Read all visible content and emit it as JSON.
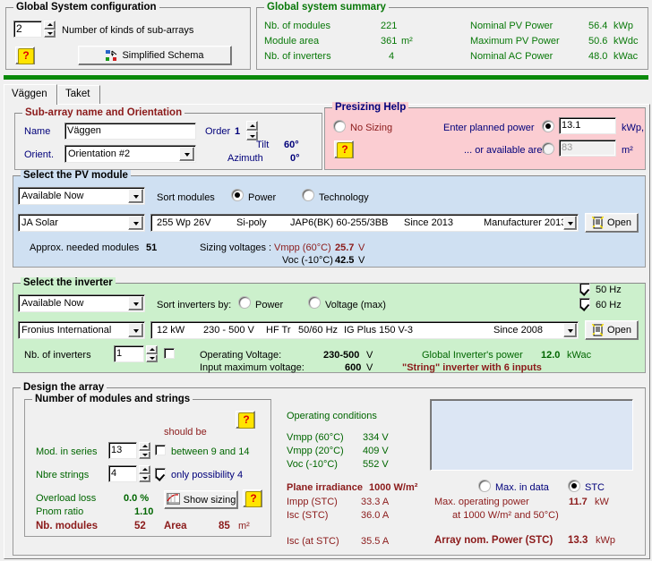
{
  "global_config": {
    "title": "Global System configuration",
    "subarray_kinds_value": "2",
    "subarray_kinds_label": "Number of kinds of sub-arrays",
    "simplified_schema_button": "Simplified Schema",
    "help_icon": "help-question-icon"
  },
  "global_summary": {
    "title": "Global system summary",
    "rows_left": [
      {
        "label": "Nb. of modules",
        "value": "221",
        "unit": ""
      },
      {
        "label": "Module area",
        "value": "361",
        "unit": "m²"
      },
      {
        "label": "Nb. of inverters",
        "value": "4",
        "unit": ""
      }
    ],
    "rows_right": [
      {
        "label": "Nominal PV Power",
        "value": "56.4",
        "unit": "kWp"
      },
      {
        "label": "Maximum PV Power",
        "value": "50.6",
        "unit": "kWdc"
      },
      {
        "label": "Nominal AC Power",
        "value": "48.0",
        "unit": "kWac"
      }
    ]
  },
  "tabs": [
    {
      "label": "Väggen",
      "active": true
    },
    {
      "label": "Taket",
      "active": false
    }
  ],
  "subarray": {
    "title": "Sub-array name and Orientation",
    "name_label": "Name",
    "name_value": "Väggen",
    "orient_label": "Orient.",
    "orient_value": "Orientation #2",
    "order_label": "Order",
    "order_value": "1",
    "tilt_label": "Tilt",
    "tilt_value": "60°",
    "azimuth_label": "Azimuth",
    "azimuth_value": "0°"
  },
  "presizing": {
    "title": "Presizing Help",
    "no_sizing_label": "No Sizing",
    "no_sizing_selected": false,
    "planned_power_label": "Enter planned power",
    "planned_power_selected": true,
    "planned_power_value": "13.1",
    "planned_power_unit": "kWp,",
    "available_area_label": "... or available area",
    "available_area_selected": false,
    "available_area_value": "83",
    "available_area_unit": "m²"
  },
  "pv_module": {
    "title": "Select the PV module",
    "availability_value": "Available Now",
    "sort_label": "Sort modules",
    "sort_power_label": "Power",
    "sort_power_selected": true,
    "sort_technology_label": "Technology",
    "sort_technology_selected": false,
    "manufacturer_value": "JA Solar",
    "model": {
      "power": "255 Wp 26V",
      "tech": "Si-poly",
      "code": "JAP6(BK) 60-255/3BB",
      "since": "Since 2013",
      "source": "Manufacturer 2013"
    },
    "open_button": "Open",
    "approx_label": "Approx. needed modules",
    "approx_value": "51",
    "sizing_voltages_label": "Sizing voltages :",
    "vmpp_label": "Vmpp (60°C)",
    "vmpp_value": "25.7",
    "vmpp_unit": "V",
    "voc_label": "Voc  (-10°C)",
    "voc_value": "42.5",
    "voc_unit": "V"
  },
  "inverter": {
    "title": "Select the inverter",
    "availability_value": "Available Now",
    "sort_label": "Sort inverters by:",
    "sort_power_label": "Power",
    "sort_power_selected": false,
    "sort_voltage_label": "Voltage (max)",
    "sort_voltage_selected": false,
    "freq_50_label": "50 Hz",
    "freq_50_checked": true,
    "freq_60_label": "60 Hz",
    "freq_60_checked": true,
    "manufacturer_value": "Fronius International",
    "model": {
      "power": "12 kW",
      "voltage": "230 - 500 V",
      "type": "HF Tr",
      "freq": "50/60 Hz",
      "name": "IG Plus 150 V-3",
      "since": "Since 2008"
    },
    "open_button": "Open",
    "nb_inverters_label": "Nb. of inverters",
    "nb_inverters_value": "1",
    "nb_inverters_checked": false,
    "operating_voltage_label": "Operating Voltage:",
    "operating_voltage_value": "230-500",
    "operating_voltage_unit": "V",
    "input_max_voltage_label": "Input maximum voltage:",
    "input_max_voltage_value": "600",
    "input_max_voltage_unit": "V",
    "global_power_label": "Global Inverter's power",
    "global_power_value": "12.0",
    "global_power_unit": "kWac",
    "string_note": "\"String\" inverter with 6 inputs"
  },
  "design": {
    "title": "Design the array",
    "modules_strings": {
      "title": "Number of modules and strings",
      "should_be_label": "should be",
      "mod_series_label": "Mod. in series",
      "mod_series_value": "13",
      "mod_series_checked": false,
      "between_label": "between 9 and 14",
      "nbre_strings_label": "Nbre strings",
      "nbre_strings_value": "4",
      "only_possibility_checked": true,
      "only_possibility_label": "only possibility 4",
      "overload_loss_label": "Overload loss",
      "overload_loss_value": "0.0 %",
      "pnom_ratio_label": "Pnom ratio",
      "pnom_ratio_value": "1.10",
      "show_sizing_button": "Show sizing",
      "nb_modules_label": "Nb. modules",
      "nb_modules_value": "52",
      "area_label": "Area",
      "area_value": "85",
      "area_unit": "m²"
    },
    "operating_conditions": {
      "title": "Operating conditions",
      "rows": [
        {
          "label": "Vmpp (60°C)",
          "value": "334 V"
        },
        {
          "label": "Vmpp (20°C)",
          "value": "409 V"
        },
        {
          "label": "Voc  (-10°C)",
          "value": "552 V"
        }
      ],
      "plane_irradiance_label": "Plane irradiance",
      "plane_irradiance_value": "1000 W/m²",
      "impp_label": "Impp (STC)",
      "impp_value": "33.3 A",
      "isc_label": "Isc  (STC)",
      "isc_value": "36.0 A",
      "isc_at_stc_label": "Isc (at STC)",
      "isc_at_stc_value": "35.5 A"
    },
    "max_in_data_label": "Max. in data",
    "max_in_data_selected": false,
    "stc_label": "STC",
    "stc_selected": true,
    "max_op_power_label": "Max. operating power",
    "max_op_power_cond": "at 1000 W/m² and 50°C)",
    "max_op_power_value": "11.7",
    "max_op_power_unit": "kW",
    "array_nom_power_label": "Array nom. Power (STC)",
    "array_nom_power_value": "13.3",
    "array_nom_power_unit": "kWp"
  }
}
